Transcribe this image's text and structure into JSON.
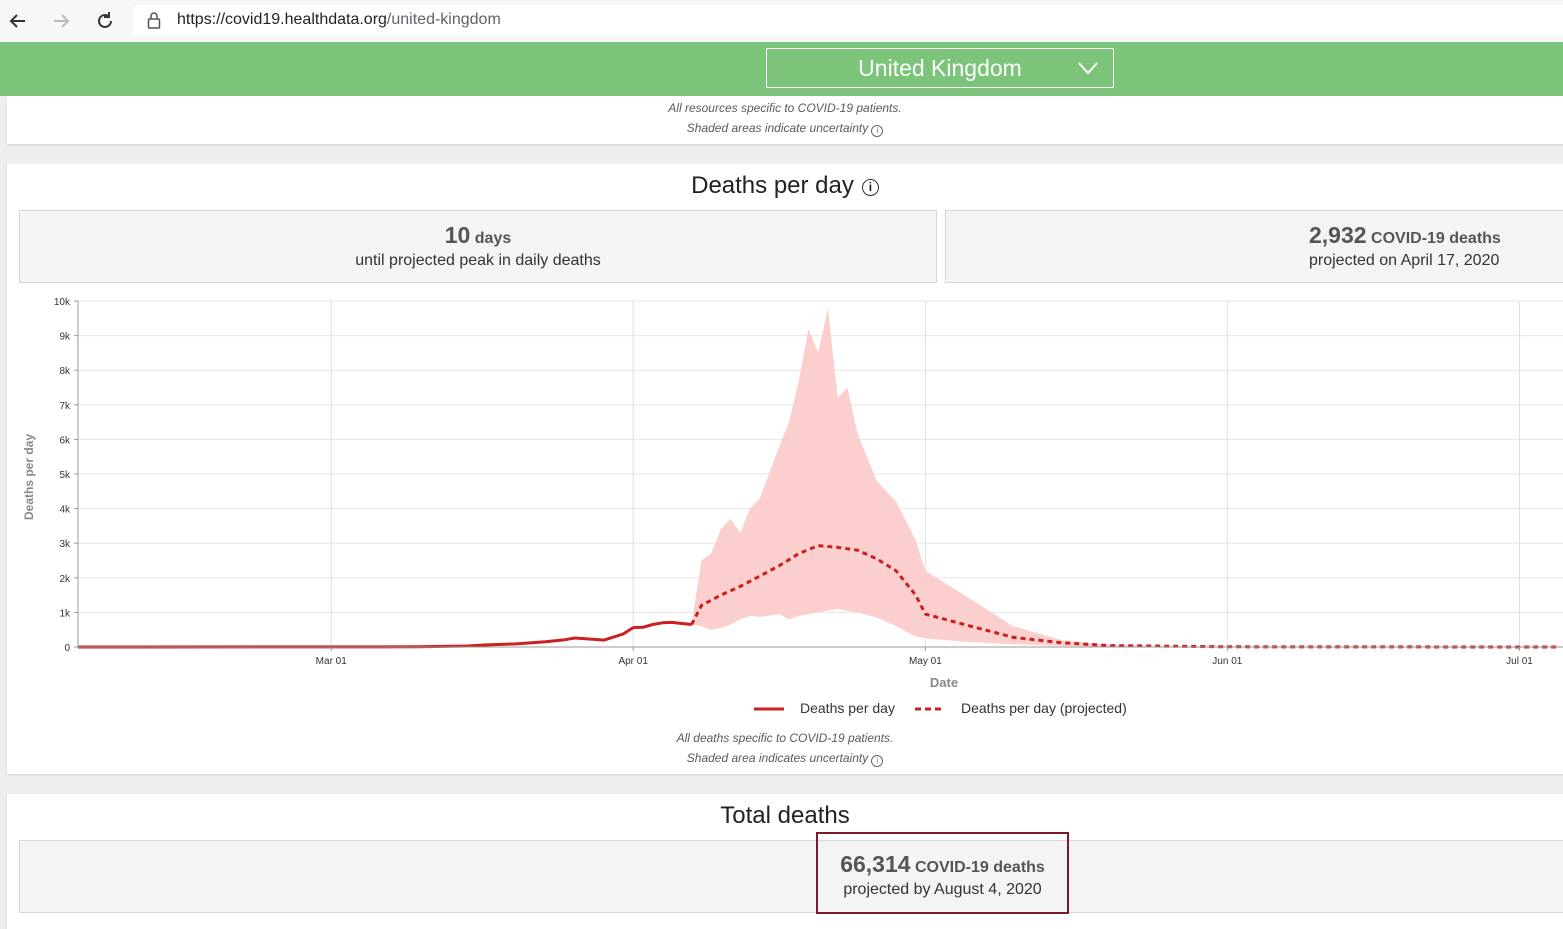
{
  "browser": {
    "url_base": "https://covid19.healthdata.org",
    "url_path": "/united-kingdom",
    "icons": [
      "back-arrow-icon",
      "forward-arrow-icon",
      "reload-icon",
      "lock-icon"
    ]
  },
  "header": {
    "country": "United Kingdom",
    "bg_color": "#7bc47a"
  },
  "top_card": {
    "note1": "All resources specific to COVID-19 patients.",
    "note2": "Shaded areas indicate uncertainty"
  },
  "deaths_card": {
    "title": "Deaths per day",
    "stat1": {
      "num": "10",
      "unit": "days",
      "sub": "until projected peak in daily deaths"
    },
    "stat2": {
      "num": "2,932",
      "unit": "COVID-19 deaths",
      "sub": "projected on April 17, 2020"
    },
    "legend": {
      "actual": "Deaths per day",
      "projected": "Deaths per day (projected)"
    },
    "note1": "All deaths specific to COVID-19 patients.",
    "note2": "Shaded area indicates uncertainty"
  },
  "total_card": {
    "title": "Total deaths",
    "num": "66,314",
    "unit": "COVID-19 deaths",
    "sub": "projected by August 4, 2020"
  },
  "chart_data": {
    "type": "line",
    "xlabel": "Date",
    "ylabel": "Deaths per day",
    "x_ticks": [
      "Mar 01",
      "Apr 01",
      "May 01",
      "Jun 01",
      "Jul 01"
    ],
    "y_ticks": [
      "0",
      "1k",
      "2k",
      "3k",
      "4k",
      "5k",
      "6k",
      "7k",
      "8k",
      "9k",
      "10k"
    ],
    "ylim": [
      0,
      10000
    ],
    "grid": true,
    "line_color": "#cc1f1f",
    "band_color": "#fccaca",
    "series": [
      {
        "name": "Deaths per day",
        "style": "solid",
        "x": [
          "2020-02-04",
          "2020-03-10",
          "2020-03-15",
          "2020-03-17",
          "2020-03-20",
          "2020-03-23",
          "2020-03-25",
          "2020-03-26",
          "2020-03-28",
          "2020-03-29",
          "2020-03-31",
          "2020-04-01",
          "2020-04-02",
          "2020-04-03",
          "2020-04-04",
          "2020-04-05",
          "2020-04-06",
          "2020-04-07"
        ],
        "y": [
          0,
          5,
          30,
          60,
          90,
          150,
          210,
          260,
          220,
          200,
          380,
          560,
          570,
          650,
          700,
          710,
          680,
          650
        ]
      },
      {
        "name": "Deaths per day (projected)",
        "style": "dashed",
        "x": [
          "2020-04-07",
          "2020-04-08",
          "2020-04-10",
          "2020-04-12",
          "2020-04-14",
          "2020-04-16",
          "2020-04-18",
          "2020-04-20",
          "2020-04-22",
          "2020-04-24",
          "2020-04-26",
          "2020-04-28",
          "2020-04-30",
          "2020-05-01",
          "2020-05-05",
          "2020-05-10",
          "2020-05-15",
          "2020-05-20",
          "2020-06-01",
          "2020-07-01",
          "2020-07-05"
        ],
        "y": [
          650,
          1200,
          1500,
          1750,
          2050,
          2350,
          2700,
          2932,
          2880,
          2800,
          2550,
          2200,
          1500,
          950,
          650,
          280,
          120,
          40,
          5,
          0,
          0
        ]
      }
    ],
    "uncertainty_band": {
      "x": [
        "2020-04-07",
        "2020-04-08",
        "2020-04-09",
        "2020-04-10",
        "2020-04-11",
        "2020-04-12",
        "2020-04-13",
        "2020-04-14",
        "2020-04-16",
        "2020-04-17",
        "2020-04-18",
        "2020-04-19",
        "2020-04-20",
        "2020-04-21",
        "2020-04-22",
        "2020-04-23",
        "2020-04-24",
        "2020-04-26",
        "2020-04-28",
        "2020-04-30",
        "2020-05-01",
        "2020-05-05",
        "2020-05-10",
        "2020-05-15",
        "2020-05-20",
        "2020-05-25",
        "2020-06-01"
      ],
      "upper": [
        650,
        2500,
        2700,
        3400,
        3700,
        3300,
        4000,
        4300,
        5800,
        6500,
        7700,
        9200,
        8500,
        9800,
        7200,
        7500,
        6200,
        4800,
        4200,
        3100,
        2200,
        1500,
        600,
        200,
        60,
        15,
        0
      ],
      "lower": [
        650,
        600,
        500,
        550,
        650,
        800,
        900,
        870,
        950,
        800,
        900,
        950,
        1000,
        1050,
        1100,
        1050,
        1000,
        850,
        600,
        300,
        250,
        150,
        80,
        30,
        10,
        0,
        0
      ]
    }
  }
}
